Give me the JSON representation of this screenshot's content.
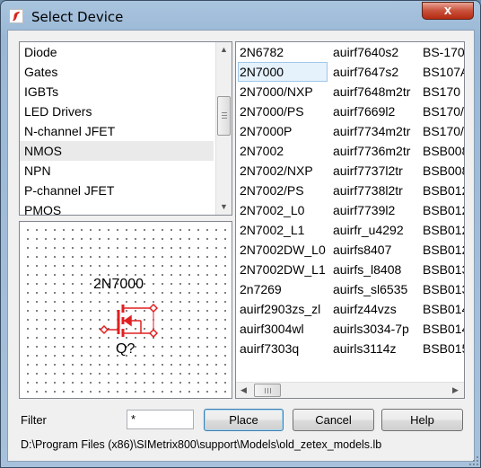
{
  "window": {
    "title": "Select Device",
    "close_label": "x"
  },
  "categories": {
    "items": [
      {
        "label": "Diode",
        "selected": false
      },
      {
        "label": "Gates",
        "selected": false
      },
      {
        "label": "IGBTs",
        "selected": false
      },
      {
        "label": "LED Drivers",
        "selected": false
      },
      {
        "label": "N-channel JFET",
        "selected": false
      },
      {
        "label": "NMOS",
        "selected": true
      },
      {
        "label": "NPN",
        "selected": false
      },
      {
        "label": "P-channel JFET",
        "selected": false
      },
      {
        "label": "PMOS",
        "selected": false
      }
    ]
  },
  "preview": {
    "part_name": "2N7000",
    "ref_designator": "Q?",
    "symbol_color": "#e02020"
  },
  "devices": {
    "selected": "2N7000",
    "rows": [
      [
        "2N6782",
        "auirf7640s2",
        "BS-170"
      ],
      [
        "2N7000",
        "auirf7647s2",
        "BS107A"
      ],
      [
        "2N7000/NXP",
        "auirf7648m2tr",
        "BS170"
      ],
      [
        "2N7000/PS",
        "auirf7669l2",
        "BS170/"
      ],
      [
        "2N7000P",
        "auirf7734m2tr",
        "BS170/"
      ],
      [
        "2N7002",
        "auirf7736m2tr",
        "BSB008"
      ],
      [
        "2N7002/NXP",
        "auirf7737l2tr",
        "BSB008"
      ],
      [
        "2N7002/PS",
        "auirf7738l2tr",
        "BSB012"
      ],
      [
        "2N7002_L0",
        "auirf7739l2",
        "BSB012"
      ],
      [
        "2N7002_L1",
        "auirfr_u4292",
        "BSB012"
      ],
      [
        "2N7002DW_L0",
        "auirfs8407",
        "BSB012"
      ],
      [
        "2N7002DW_L1",
        "auirfs_l8408",
        "BSB013"
      ],
      [
        "2n7269",
        "auirfs_sl6535",
        "BSB013"
      ],
      [
        "auirf2903zs_zl",
        "auirfz44vzs",
        "BSB014"
      ],
      [
        "auirf3004wl",
        "auirls3034-7p",
        "BSB014"
      ],
      [
        "auirf7303q",
        "auirls3114z",
        "BSB015"
      ]
    ]
  },
  "filter": {
    "label": "Filter",
    "value": "*"
  },
  "buttons": {
    "place": "Place",
    "cancel": "Cancel",
    "help": "Help"
  },
  "status": {
    "path": "D:\\Program Files (x86)\\SIMetrix800\\support\\Models\\old_zetex_models.lb"
  }
}
